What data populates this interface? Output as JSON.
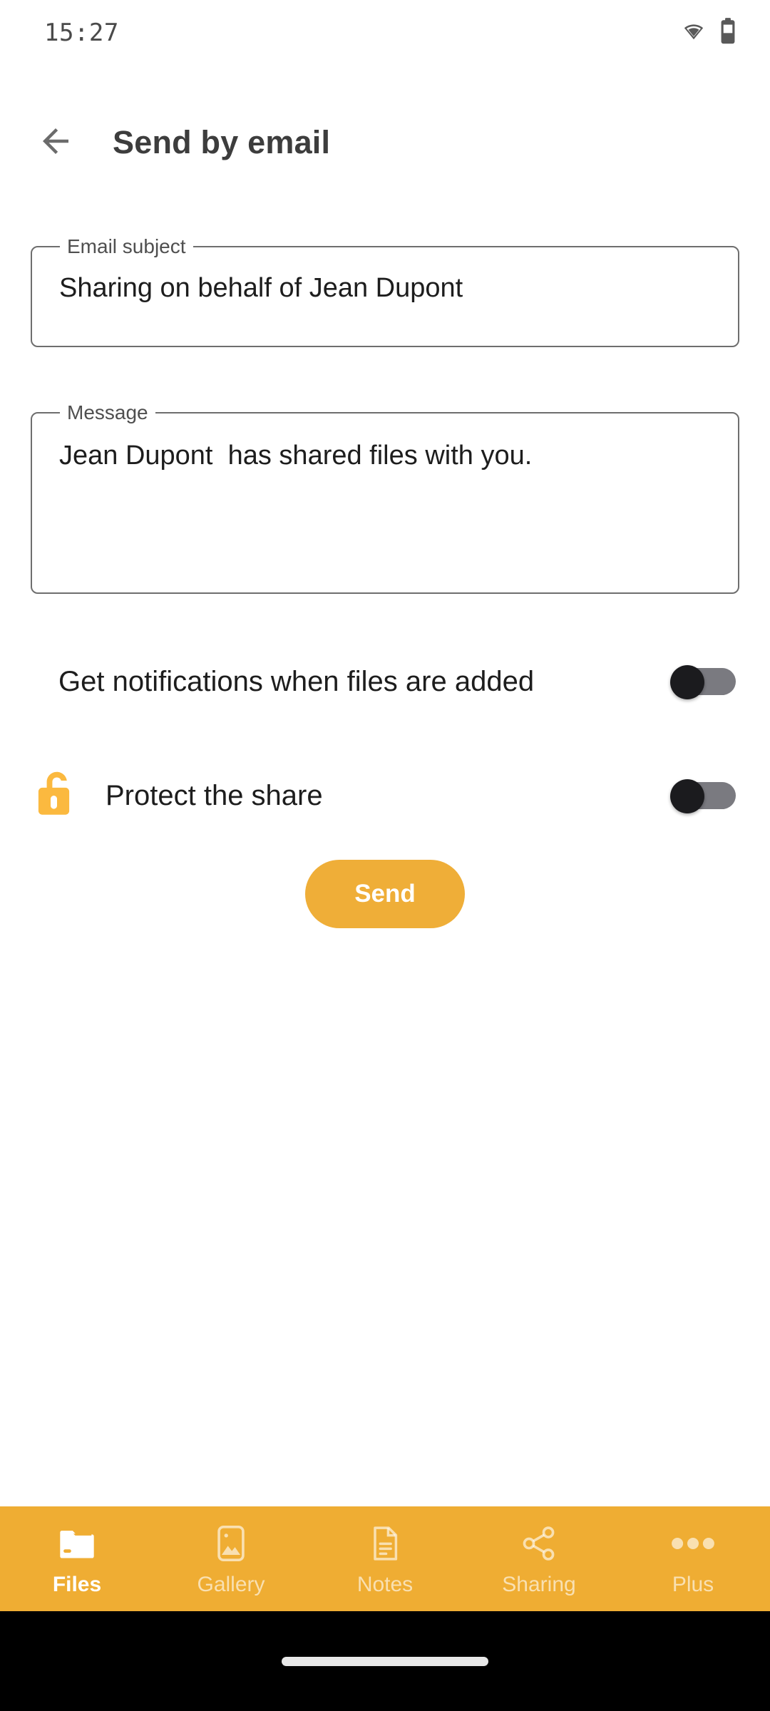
{
  "status_bar": {
    "time": "15:27",
    "wifi_icon": "wifi-icon",
    "battery_icon": "battery-icon"
  },
  "header": {
    "back_icon": "back-arrow-icon",
    "title": "Send by email"
  },
  "form": {
    "subject_field": {
      "label": "Email subject",
      "value": "Sharing on behalf of Jean Dupont",
      "placeholder": "Email subject"
    },
    "message_field": {
      "label": "Message",
      "value": "Jean Dupont  has shared files with you.",
      "placeholder": "Message"
    }
  },
  "settings": [
    {
      "label": "Get notifications when files are added",
      "toggle_state": "off",
      "icon": ""
    },
    {
      "label": "Protect the share",
      "toggle_state": "off",
      "icon": "unlocked-padlock-icon"
    }
  ],
  "actions": {
    "send_label": "Send"
  },
  "bottom_nav": {
    "items": [
      {
        "label": "Files",
        "icon": "folder-icon",
        "active": true
      },
      {
        "label": "Gallery",
        "icon": "image-icon",
        "active": false
      },
      {
        "label": "Notes",
        "icon": "document-icon",
        "active": false
      },
      {
        "label": "Sharing",
        "icon": "share-icon",
        "active": false
      },
      {
        "label": "Plus",
        "icon": "more-dots-icon",
        "active": false
      }
    ]
  },
  "colors": {
    "accent": "#efad33",
    "send_button": "#efae38",
    "lock_icon": "#fbb93f",
    "field_border": "#6e6e6e",
    "toggle_thumb": "#1b1b1e",
    "toggle_track": "#7a7a80",
    "title_text": "#3d3d3d"
  }
}
